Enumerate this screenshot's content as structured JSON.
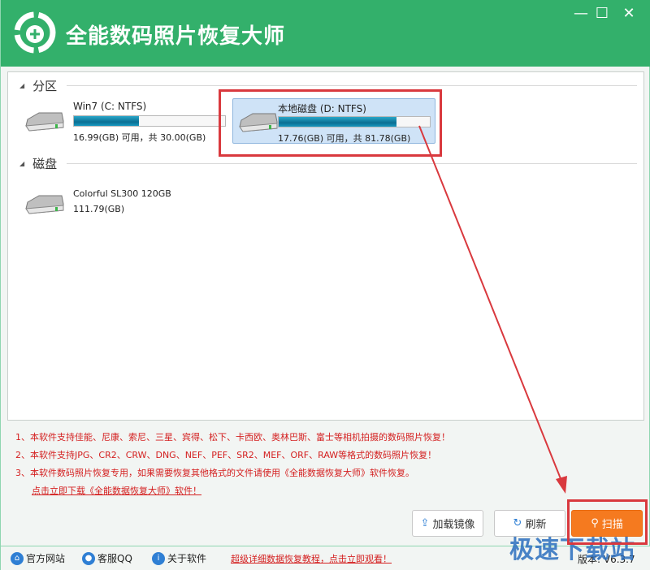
{
  "app": {
    "title": "全能数码照片恢复大师",
    "brand_color": "#33b06b",
    "window_controls": [
      "minimize",
      "maximize",
      "close"
    ]
  },
  "sections": {
    "partitions": {
      "label": "分区",
      "items": [
        {
          "name": "Win7 (C: NTFS)",
          "info": "16.99(GB) 可用，共 30.00(GB)",
          "used_percent": 43,
          "selected": false
        },
        {
          "name": "本地磁盘 (D: NTFS)",
          "info": "17.76(GB) 可用，共 81.78(GB)",
          "used_percent": 78,
          "selected": true
        }
      ]
    },
    "disks": {
      "label": "磁盘",
      "items": [
        {
          "name": "Colorful SL300 120GB",
          "info": "111.79(GB)"
        }
      ]
    }
  },
  "notes": [
    "1、本软件支持佳能、尼康、索尼、三星、宾得、松下、卡西欧、奥林巴斯、富士等相机拍摄的数码照片恢复！",
    "2、本软件支持JPG、CR2、CRW、DNG、NEF、PEF、SR2、MEF、ORF、RAW等格式的数码照片恢复！",
    "3、本软件数码照片恢复专用，如果需要恢复其他格式的文件请使用《全能数据恢复大师》软件恢复。"
  ],
  "download_link": "点击立即下载《全能数据恢复大师》软件！",
  "buttons": {
    "load_image": "加载镜像",
    "refresh": "刷新",
    "scan": "扫描"
  },
  "footer": {
    "website": "官方网站",
    "support": "客服QQ",
    "about": "关于软件",
    "tutorial_link": "超级详细数据恢复教程，点击立即观看！",
    "version": "版本: V6.3.7"
  },
  "watermark": "极速下载站"
}
